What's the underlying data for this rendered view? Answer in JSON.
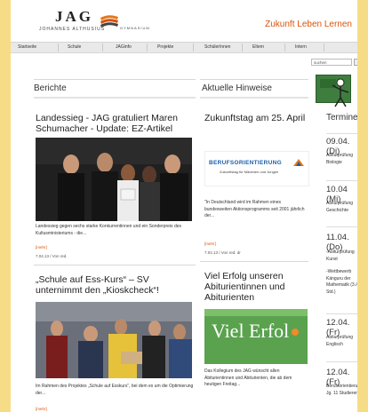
{
  "header": {
    "logo_main": "JAG",
    "logo_sub": "JOHANNES ALTHUSIUS",
    "logo_gym": "GYMNASIUM",
    "tagline": "Zukunft Leben Lernen"
  },
  "nav": {
    "items": [
      "Startseite",
      "Schule",
      "JAGinfo",
      "Projekte",
      "SchülerInnen",
      "Eltern",
      "Intern"
    ]
  },
  "search": {
    "placeholder": "suchen"
  },
  "colors": {
    "accent": "#d9530c",
    "background": "#f6dc87"
  },
  "berichte": {
    "heading": "Berichte",
    "article1": {
      "title": "Landessieg - JAG gratuliert Maren Schumacher - Update: EZ-Artikel",
      "text": "Landessieg gegen sechs starke Konkurrentinnen und ein Sonderpreis des Kultusministeriums - die...",
      "more": "[mehr]",
      "meta": "7.04.13 / Von red."
    },
    "article2": {
      "title": "„Schule auf Ess-Kurs“ – SV unternimmt den „Kioskcheck“!",
      "text": "Im Rahmen des Projektes „Schule auf Esskurs“, bei dem es um die Optimierung der...",
      "more": "[mehr]"
    }
  },
  "hinweise": {
    "heading": "Aktuelle Hinweise",
    "item1": {
      "title": "Zukunftstag am 25. April",
      "banner_title": "BERUFSORIENTIERUNG",
      "banner_sub": "Zukunftstag für Mädchen und Jungen",
      "text": "\"In Deutschland wird im Rahmen eines bundesweiten Aktionsprogramms seit 2001 jährlich der...",
      "more": "[mehr]",
      "meta": "7.04.13 / Von red. dr"
    },
    "item2": {
      "title": "Viel Erfolg unseren Abiturientinnen und Abiturienten",
      "image_text": "Viel Erfol",
      "text": "Das Kollegium des JAG wünscht allen Abiturientinnen und Abiturienten, die ab dem heutigen Freitag..."
    }
  },
  "termine": {
    "heading": "Termine",
    "entries": [
      {
        "date": "09.04. (Di)",
        "text": "Abiturprüfung Biologie"
      },
      {
        "date": "10.04 (Mi)",
        "text": "Abiturprüfung Geschichte"
      },
      {
        "date": "11.04. (Do)",
        "text": "-Abiturprüfung Kunst"
      },
      {
        "date": "",
        "text": "-Wettbewerb Känguru der Mathematik (3./4. Std.)"
      },
      {
        "date": "12.04. (Fr)",
        "text": "Abiturprüfung Englisch"
      },
      {
        "date": "12.04. (Fr)",
        "text": "Berufsorientierung Jg. 11 Studieren im"
      }
    ]
  }
}
